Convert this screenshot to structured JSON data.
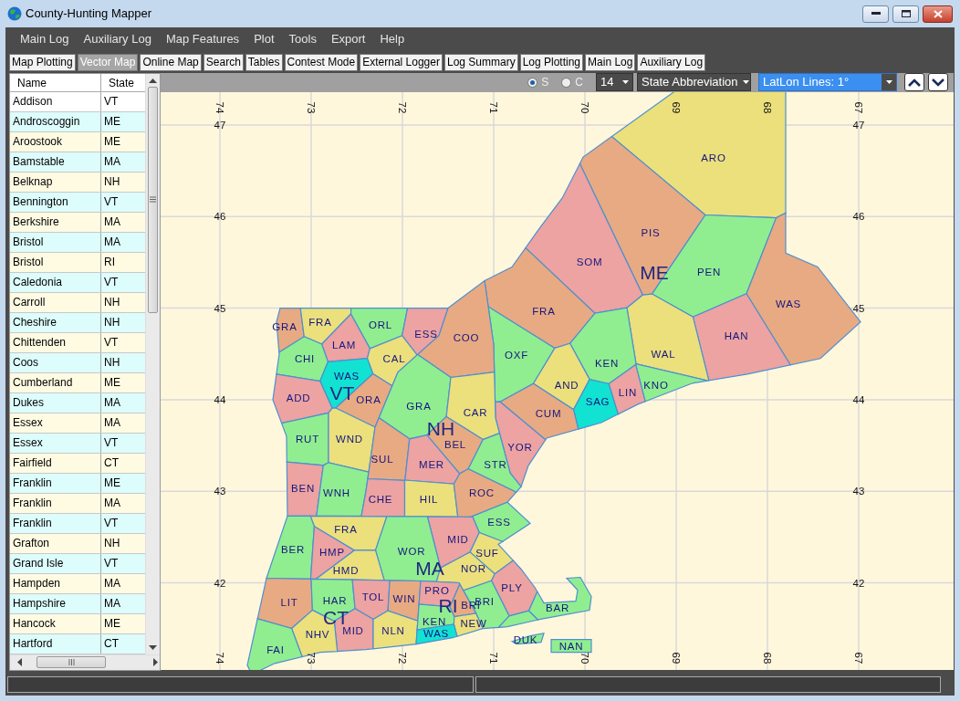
{
  "window": {
    "title": "County-Hunting Mapper"
  },
  "menu": [
    "Main Log",
    "Auxiliary Log",
    "Map Features",
    "Plot",
    "Tools",
    "Export",
    "Help"
  ],
  "tabs": [
    {
      "label": "Map Plotting",
      "selected": false
    },
    {
      "label": "Vector Map",
      "selected": true
    },
    {
      "label": "Online Map",
      "selected": false
    },
    {
      "label": "Search",
      "selected": false
    },
    {
      "label": "Tables",
      "selected": false
    },
    {
      "label": "Contest Mode",
      "selected": false
    },
    {
      "label": "External Logger",
      "selected": false
    },
    {
      "label": "Log Summary",
      "selected": false
    },
    {
      "label": "Log Plotting",
      "selected": false
    },
    {
      "label": "Main Log",
      "selected": false
    },
    {
      "label": "Auxiliary Log",
      "selected": false
    }
  ],
  "toolbar": {
    "radios": [
      {
        "label": "S",
        "selected": true
      },
      {
        "label": "C",
        "selected": false
      }
    ],
    "font_size": "14",
    "label_mode": "State Abbreviation",
    "grid_mode": "LatLon Lines: 1°"
  },
  "county_table": {
    "columns": [
      "Name",
      "State"
    ],
    "rows": [
      {
        "name": "Addison",
        "state": "VT",
        "selected": true
      },
      {
        "name": "Androscoggin",
        "state": "ME",
        "selected": false
      },
      {
        "name": "Aroostook",
        "state": "ME",
        "selected": false
      },
      {
        "name": "Bamstable",
        "state": "MA",
        "selected": false
      },
      {
        "name": "Belknap",
        "state": "NH",
        "selected": false
      },
      {
        "name": "Bennington",
        "state": "VT",
        "selected": false
      },
      {
        "name": "Berkshire",
        "state": "MA",
        "selected": false
      },
      {
        "name": "Bristol",
        "state": "MA",
        "selected": false
      },
      {
        "name": "Bristol",
        "state": "RI",
        "selected": false
      },
      {
        "name": "Caledonia",
        "state": "VT",
        "selected": false
      },
      {
        "name": "Carroll",
        "state": "NH",
        "selected": false
      },
      {
        "name": "Cheshire",
        "state": "NH",
        "selected": false
      },
      {
        "name": "Chittenden",
        "state": "VT",
        "selected": false
      },
      {
        "name": "Coos",
        "state": "NH",
        "selected": false
      },
      {
        "name": "Cumberland",
        "state": "ME",
        "selected": false
      },
      {
        "name": "Dukes",
        "state": "MA",
        "selected": false
      },
      {
        "name": "Essex",
        "state": "MA",
        "selected": false
      },
      {
        "name": "Essex",
        "state": "VT",
        "selected": false
      },
      {
        "name": "Fairfield",
        "state": "CT",
        "selected": false
      },
      {
        "name": "Franklin",
        "state": "ME",
        "selected": false
      },
      {
        "name": "Franklin",
        "state": "MA",
        "selected": false
      },
      {
        "name": "Franklin",
        "state": "VT",
        "selected": false
      },
      {
        "name": "Grafton",
        "state": "NH",
        "selected": false
      },
      {
        "name": "Grand Isle",
        "state": "VT",
        "selected": false
      },
      {
        "name": "Hampden",
        "state": "MA",
        "selected": false
      },
      {
        "name": "Hampshire",
        "state": "MA",
        "selected": false
      },
      {
        "name": "Hancock",
        "state": "ME",
        "selected": false
      },
      {
        "name": "Hartford",
        "state": "CT",
        "selected": false
      }
    ]
  },
  "map": {
    "top_labels": [
      "74",
      "73",
      "72",
      "71",
      "70",
      "69",
      "68",
      "67"
    ],
    "bottom_labels": [
      "74",
      "73",
      "72",
      "71",
      "70",
      "69",
      "68",
      "67"
    ],
    "left_labels": [
      "47",
      "46",
      "45",
      "44",
      "43",
      "42"
    ],
    "right_labels": [
      "47",
      "46",
      "45",
      "44",
      "43",
      "42"
    ],
    "states": [
      {
        "label": "ME",
        "counties": [
          {
            "label": "ARO",
            "color": "#ebe07c"
          },
          {
            "label": "PIS",
            "color": "#e8aa82"
          },
          {
            "label": "SOM",
            "color": "#eca3a1"
          },
          {
            "label": "PEN",
            "color": "#90ee90"
          },
          {
            "label": "FRA",
            "color": "#e8aa82"
          },
          {
            "label": "WAS",
            "color": "#e8aa82"
          },
          {
            "label": "OXF",
            "color": "#90ee90"
          },
          {
            "label": "HAN",
            "color": "#eca3a1"
          },
          {
            "label": "WAL",
            "color": "#ebe07c"
          },
          {
            "label": "KEN",
            "color": "#90ee90"
          },
          {
            "label": "AND",
            "color": "#ebe07c"
          },
          {
            "label": "KNO",
            "color": "#90ee90"
          },
          {
            "label": "LIN",
            "color": "#eca3a1"
          },
          {
            "label": "SAG",
            "color": "#12e2d2"
          },
          {
            "label": "CUM",
            "color": "#e8aa82"
          },
          {
            "label": "YOR",
            "color": "#eca3a1"
          }
        ]
      },
      {
        "label": "VT",
        "counties": [
          {
            "label": "GRA",
            "color": "#e8aa82"
          },
          {
            "label": "FRA",
            "color": "#ebe07c"
          },
          {
            "label": "ORL",
            "color": "#90ee90"
          },
          {
            "label": "ESS",
            "color": "#eca3a1"
          },
          {
            "label": "LAM",
            "color": "#eca3a1"
          },
          {
            "label": "CHI",
            "color": "#90ee90"
          },
          {
            "label": "CAL",
            "color": "#ebe07c"
          },
          {
            "label": "WAS",
            "color": "#12e2d2"
          },
          {
            "label": "ADD",
            "color": "#eca3a1"
          },
          {
            "label": "ORA",
            "color": "#e8aa82"
          },
          {
            "label": "RUT",
            "color": "#90ee90"
          },
          {
            "label": "WND",
            "color": "#ebe07c"
          },
          {
            "label": "BEN",
            "color": "#eca3a1"
          },
          {
            "label": "WNH",
            "color": "#90ee90"
          }
        ]
      },
      {
        "label": "NH",
        "counties": [
          {
            "label": "COO",
            "color": "#e8aa82"
          },
          {
            "label": "GRA",
            "color": "#90ee90"
          },
          {
            "label": "CAR",
            "color": "#ebe07c"
          },
          {
            "label": "BEL",
            "color": "#e8aa82"
          },
          {
            "label": "SUL",
            "color": "#e8aa82"
          },
          {
            "label": "MER",
            "color": "#eca3a1"
          },
          {
            "label": "STR",
            "color": "#90ee90"
          },
          {
            "label": "CHE",
            "color": "#eca3a1"
          },
          {
            "label": "HIL",
            "color": "#ebe07c"
          },
          {
            "label": "ROC",
            "color": "#e8aa82"
          }
        ]
      },
      {
        "label": "MA",
        "counties": [
          {
            "label": "ESS",
            "color": "#90ee90"
          },
          {
            "label": "FRA",
            "color": "#ebe07c"
          },
          {
            "label": "MID",
            "color": "#eca3a1"
          },
          {
            "label": "BER",
            "color": "#90ee90"
          },
          {
            "label": "HMP",
            "color": "#eca3a1"
          },
          {
            "label": "WOR",
            "color": "#90ee90"
          },
          {
            "label": "SUF",
            "color": "#ebe07c"
          },
          {
            "label": "NOR",
            "color": "#ebe07c"
          },
          {
            "label": "HMD",
            "color": "#ebe07c"
          },
          {
            "label": "PLY",
            "color": "#eca3a1"
          },
          {
            "label": "BRI",
            "color": "#90ee90"
          },
          {
            "label": "BAR",
            "color": "#90ee90"
          },
          {
            "label": "DUK",
            "color": "#90ee90"
          },
          {
            "label": "NAN",
            "color": "#90ee90"
          }
        ]
      },
      {
        "label": "CT",
        "counties": [
          {
            "label": "LIT",
            "color": "#e8aa82"
          },
          {
            "label": "HAR",
            "color": "#90ee90"
          },
          {
            "label": "TOL",
            "color": "#eca3a1"
          },
          {
            "label": "WIN",
            "color": "#e8aa82"
          },
          {
            "label": "MID",
            "color": "#eca3a1"
          },
          {
            "label": "NHV",
            "color": "#ebe07c"
          },
          {
            "label": "NLN",
            "color": "#ebe07c"
          },
          {
            "label": "FAI",
            "color": "#90ee90"
          }
        ]
      },
      {
        "label": "RI",
        "counties": [
          {
            "label": "PRO",
            "color": "#eca3a1"
          },
          {
            "label": "BRI",
            "color": "#e8aa82"
          },
          {
            "label": "KEN",
            "color": "#90ee90"
          },
          {
            "label": "NEW",
            "color": "#ebe07c"
          },
          {
            "label": "WAS",
            "color": "#12e2d2"
          }
        ]
      }
    ]
  }
}
